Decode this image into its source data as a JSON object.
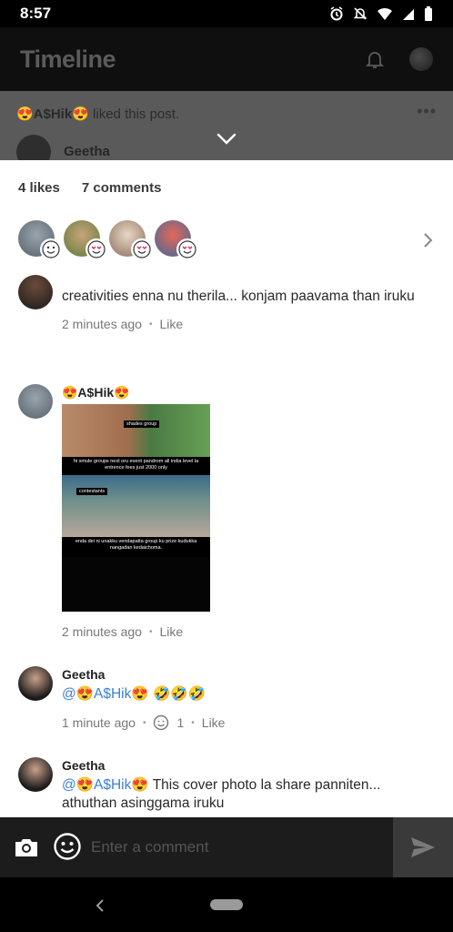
{
  "status_bar": {
    "time": "8:57"
  },
  "background": {
    "title": "Timeline",
    "liked_user": "😍A$Hik😍",
    "liked_text": "liked this post.",
    "author": "Geetha"
  },
  "sheet": {
    "likes_count": "4 likes",
    "comments_count": "7 comments",
    "comments": [
      {
        "name": "",
        "text": "creativities enna nu therila... konjam paavama than iruku",
        "time": "2 minutes ago",
        "like_label": "Like"
      },
      {
        "name": "😍A$Hik😍",
        "time": "2 minutes ago",
        "like_label": "Like",
        "meme": {
          "tag_top": "shades group",
          "caption_1": "hi smule groups next oru event pandrom all india level la entrence fees just 2000 only",
          "tag_mid": "contestants",
          "caption_2": "enda dei ni unakku vendapatta group ku prize kudukka nangadan kedaichoma."
        }
      },
      {
        "name": "Geetha",
        "mention": "@😍A$Hik😍",
        "text": " 🤣🤣🤣",
        "time": "1 minute ago",
        "reaction_count": "1",
        "like_label": "Like"
      },
      {
        "name": "Geetha",
        "mention": "@😍A$Hik😍",
        "text": " This cover photo la share panniten... athuthan asinggama iruku"
      }
    ]
  },
  "composer": {
    "placeholder": "Enter a comment"
  },
  "colors": {
    "mention": "#3b7fd6",
    "composer_bg": "#1c1c1c",
    "sheet_bg": "#ffffff"
  }
}
